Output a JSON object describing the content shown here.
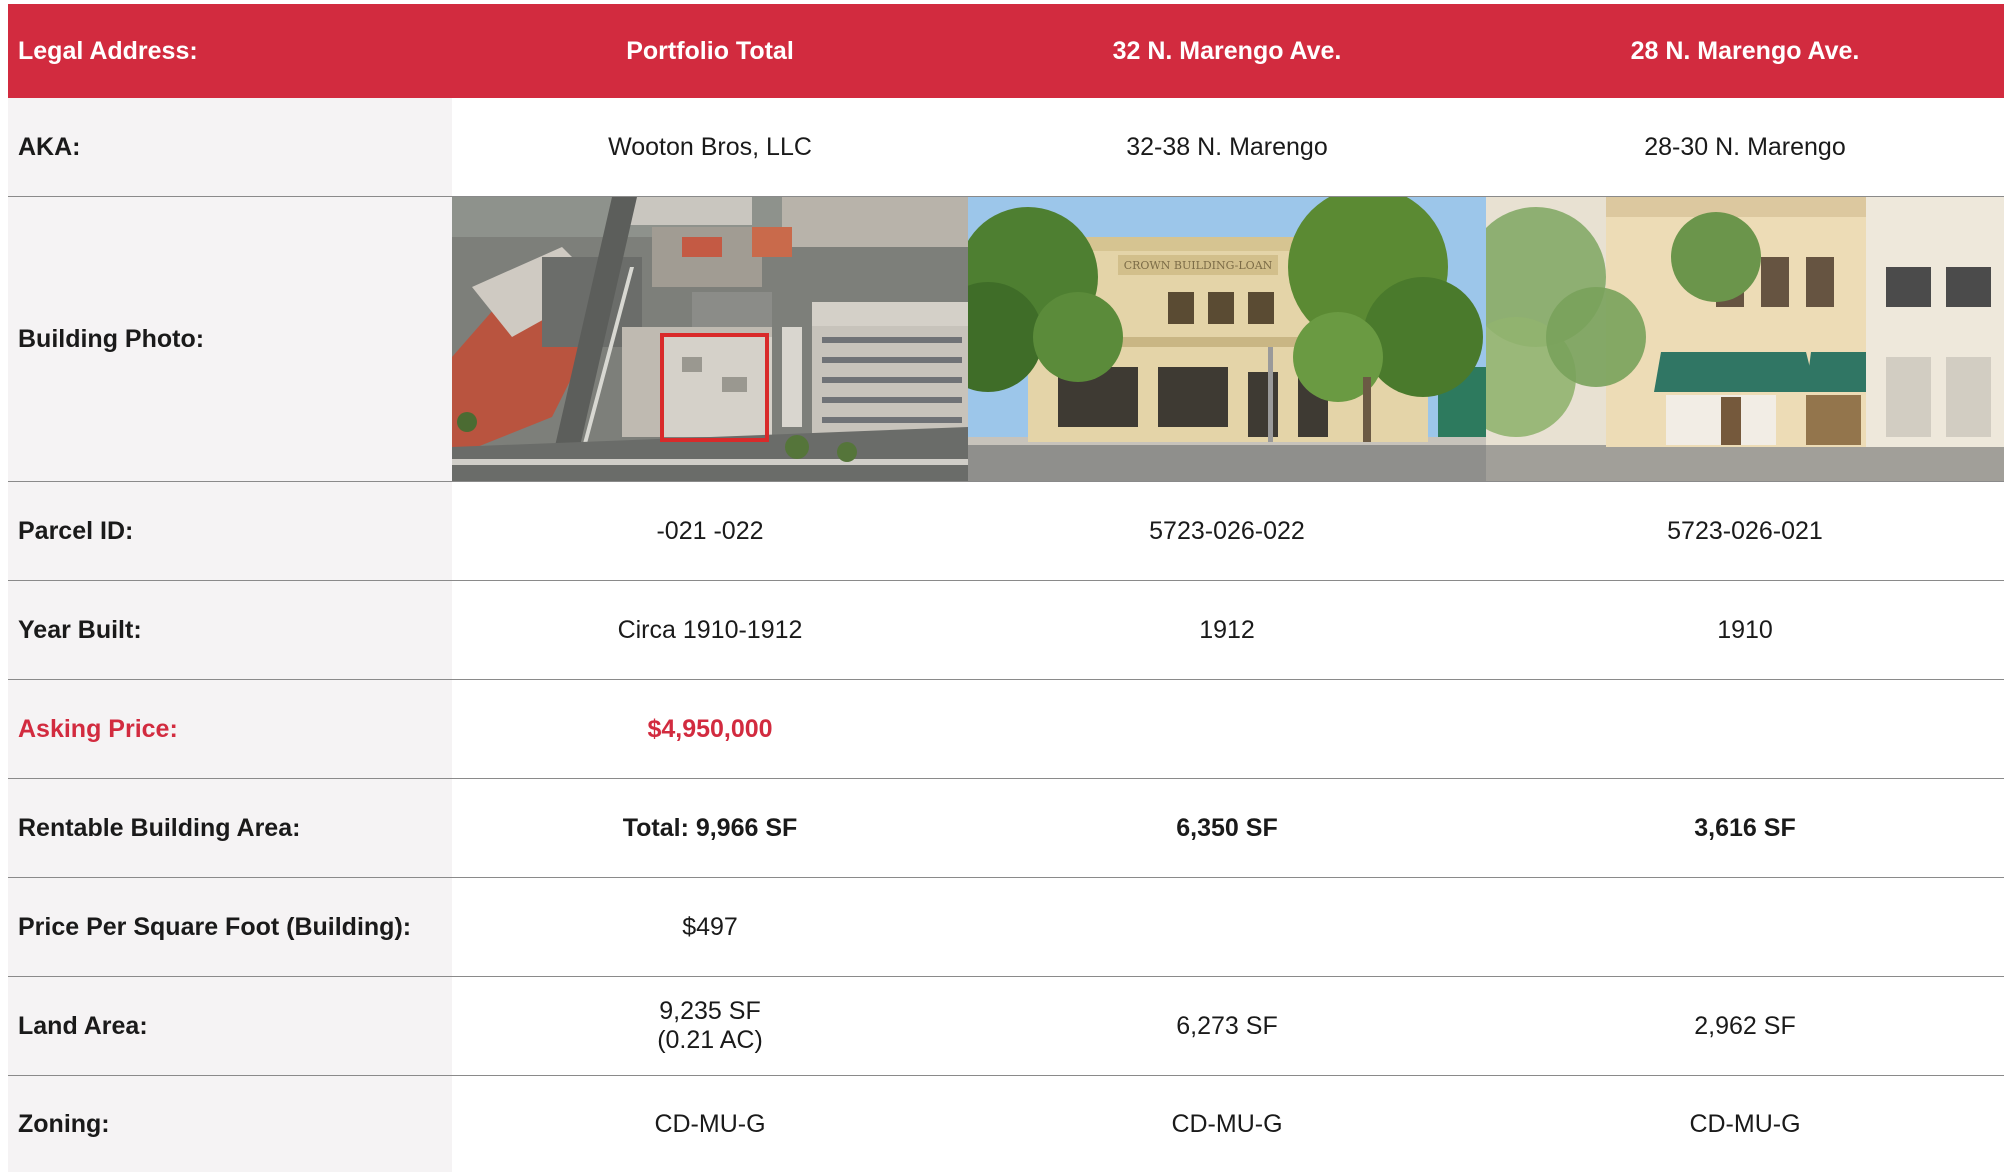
{
  "header": {
    "label": "Legal Address:",
    "columns": [
      "Portfolio Total",
      "32 N. Marengo Ave.",
      "28 N. Marengo Ave."
    ]
  },
  "rows": {
    "aka": {
      "label": "AKA:",
      "values": [
        "Wooton Bros, LLC",
        "32-38 N. Marengo",
        "28-30 N. Marengo"
      ]
    },
    "photo": {
      "label": "Building Photo:"
    },
    "parcel": {
      "label": "Parcel ID:",
      "values": [
        "-021 -022",
        "5723-026-022",
        "5723-026-021"
      ]
    },
    "year": {
      "label": "Year Built:",
      "values": [
        "Circa 1910-1912",
        "1912",
        "1910"
      ]
    },
    "price": {
      "label": "Asking Price:",
      "values": [
        "$4,950,000",
        "",
        ""
      ]
    },
    "area": {
      "label": "Rentable Building Area:",
      "values": [
        "Total: 9,966 SF",
        "6,350 SF",
        "3,616 SF"
      ]
    },
    "ppsf": {
      "label": "Price Per Square Foot (Building):",
      "values": [
        "$497",
        "",
        ""
      ]
    },
    "land": {
      "label": "Land Area:",
      "values": [
        "9,235 SF",
        "(0.21 AC)",
        "6,273 SF",
        "2,962 SF"
      ]
    },
    "zoning": {
      "label": "Zoning:",
      "values": [
        "CD-MU-G",
        "CD-MU-G",
        "CD-MU-G"
      ]
    }
  },
  "photo_sign": "CROWN BUILDING-LOAN",
  "colors": {
    "accent": "#d22b3f",
    "label_bg": "#f5f3f4",
    "awning": "#1f6b57"
  }
}
